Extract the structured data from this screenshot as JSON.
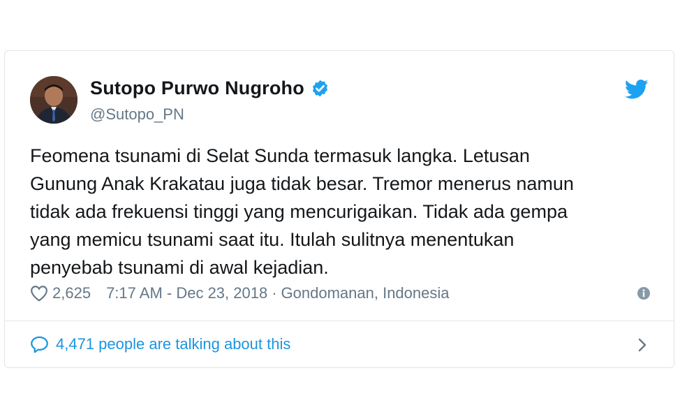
{
  "tweet": {
    "display_name": "Sutopo Purwo Nugroho",
    "handle": "@Sutopo_PN",
    "verified_icon": "verified-badge-icon",
    "platform_icon": "twitter-bird-icon",
    "text": "Feomena tsunami di Selat Sunda termasuk langka. Letusan\nGunung Anak Krakatau juga tidak besar. Tremor menerus namun\ntidak ada frekuensi tinggi yang mencurigaikan. Tidak ada gempa\nyang memicu tsunami saat itu. Itulah sulitnya menentukan\npenyebab tsunami di awal kejadian.",
    "likes": "2,625",
    "time": "7:17 AM - Dec 23, 2018",
    "separator": "·",
    "location": "Gondomanan, Indonesia",
    "talking": "4,471 people are talking about this"
  },
  "colors": {
    "text": "#14171a",
    "secondary": "#657786",
    "accent": "#1da1f2",
    "link": "#1b95e0",
    "border": "#e1e8ed"
  }
}
